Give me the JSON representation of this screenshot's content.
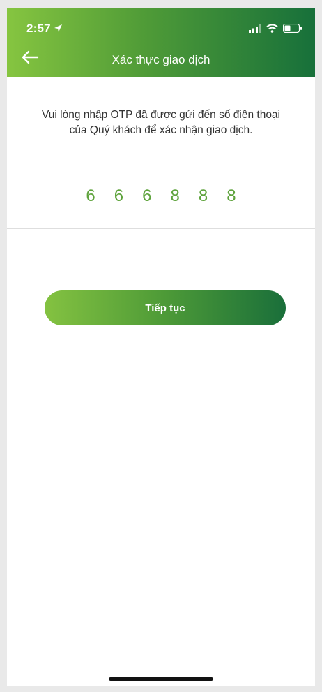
{
  "status_bar": {
    "time": "2:57"
  },
  "header": {
    "title": "Xác thực giao dịch"
  },
  "instruction": {
    "line1": "Vui lòng nhập OTP đã được gửi đến số điện thoại",
    "line2": "của Quý khách để xác nhận giao dịch."
  },
  "otp": {
    "digits": [
      "6",
      "6",
      "6",
      "8",
      "8",
      "8"
    ]
  },
  "continue_button": {
    "label": "Tiếp tục"
  },
  "colors": {
    "brand_green_light": "#86c540",
    "brand_green_dark": "#17703a",
    "otp_digit": "#5ea33c"
  }
}
